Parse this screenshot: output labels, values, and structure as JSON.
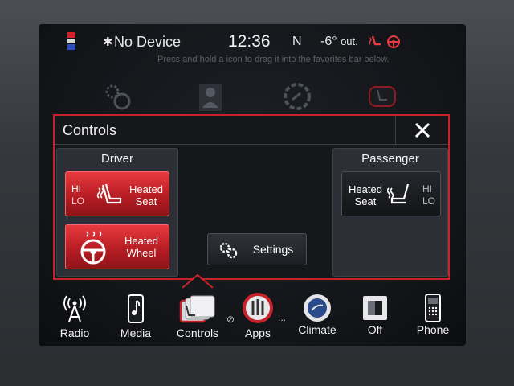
{
  "status": {
    "device": "No Device",
    "time": "12:36",
    "compass": "N",
    "temperature": "-6°",
    "temp_suffix": "out.",
    "hint": "Press and hold a icon to drag it into the favorites bar below."
  },
  "popup": {
    "title": "Controls",
    "driver": {
      "title": "Driver",
      "heated_seat": {
        "label_line1": "Heated",
        "label_line2": "Seat",
        "hi": "HI",
        "lo": "LO"
      },
      "heated_wheel": {
        "label_line1": "Heated",
        "label_line2": "Wheel"
      }
    },
    "settings": {
      "label": "Settings"
    },
    "passenger": {
      "title": "Passenger",
      "heated_seat": {
        "label_line1": "Heated",
        "label_line2": "Seat",
        "hi": "HI",
        "lo": "LO"
      }
    }
  },
  "nav": {
    "items": [
      {
        "label": "Radio",
        "icon": "radio-tower-icon"
      },
      {
        "label": "Media",
        "icon": "media-icon"
      },
      {
        "label": "Controls",
        "icon": "controls-icon"
      },
      {
        "label": "Apps",
        "icon": "apps-icon"
      },
      {
        "label": "Climate",
        "icon": "climate-icon"
      },
      {
        "label": "Off",
        "icon": "screen-off-icon"
      },
      {
        "label": "Phone",
        "icon": "phone-icon"
      }
    ]
  },
  "colors": {
    "accent_red": "#c8232c",
    "active_button": "#d62a30",
    "panel": "#2c2f35",
    "background": "#121418"
  }
}
